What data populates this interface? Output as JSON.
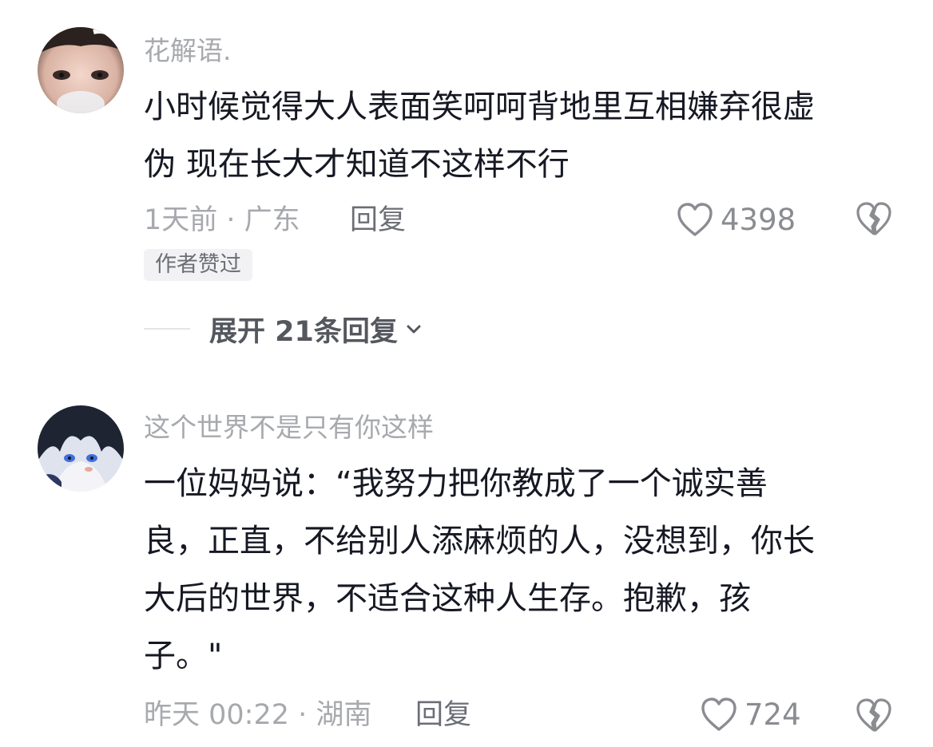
{
  "comments": [
    {
      "avatar": "user-avatar-photo",
      "username": "花解语.",
      "content_lines": [
        "小时候觉得大人表面笑呵呵背地里互相嫌弃很虚",
        "伪 现在长大才知道不这样不行"
      ],
      "time_location": "1天前 · 广东",
      "reply_label": "回复",
      "like_count": "4398",
      "like_icon": "heart-icon",
      "dislike_icon": "broken-heart-icon",
      "badge": "作者赞过",
      "expand_label": "展开 21条回复",
      "expand_icon": "chevron-down-icon"
    },
    {
      "avatar": "user-avatar-anime",
      "username": "这个世界不是只有你这样",
      "content_lines": [
        "一位妈妈说：“我努力把你教成了一个诚实善",
        "良，正直，不给别人添麻烦的人，没想到，你长",
        "大后的世界，不适合这种人生存。抱歉，孩",
        "子。\""
      ],
      "time_location": "昨天 00:22 · 湖南",
      "reply_label": "回复",
      "like_count": "724",
      "like_icon": "heart-icon",
      "dislike_icon": "broken-heart-icon"
    }
  ],
  "colors": {
    "text_primary": "#161823",
    "text_secondary": "#a7a9ad",
    "badge_bg": "#f2f2f4",
    "icon_gray": "#8a8c91"
  }
}
